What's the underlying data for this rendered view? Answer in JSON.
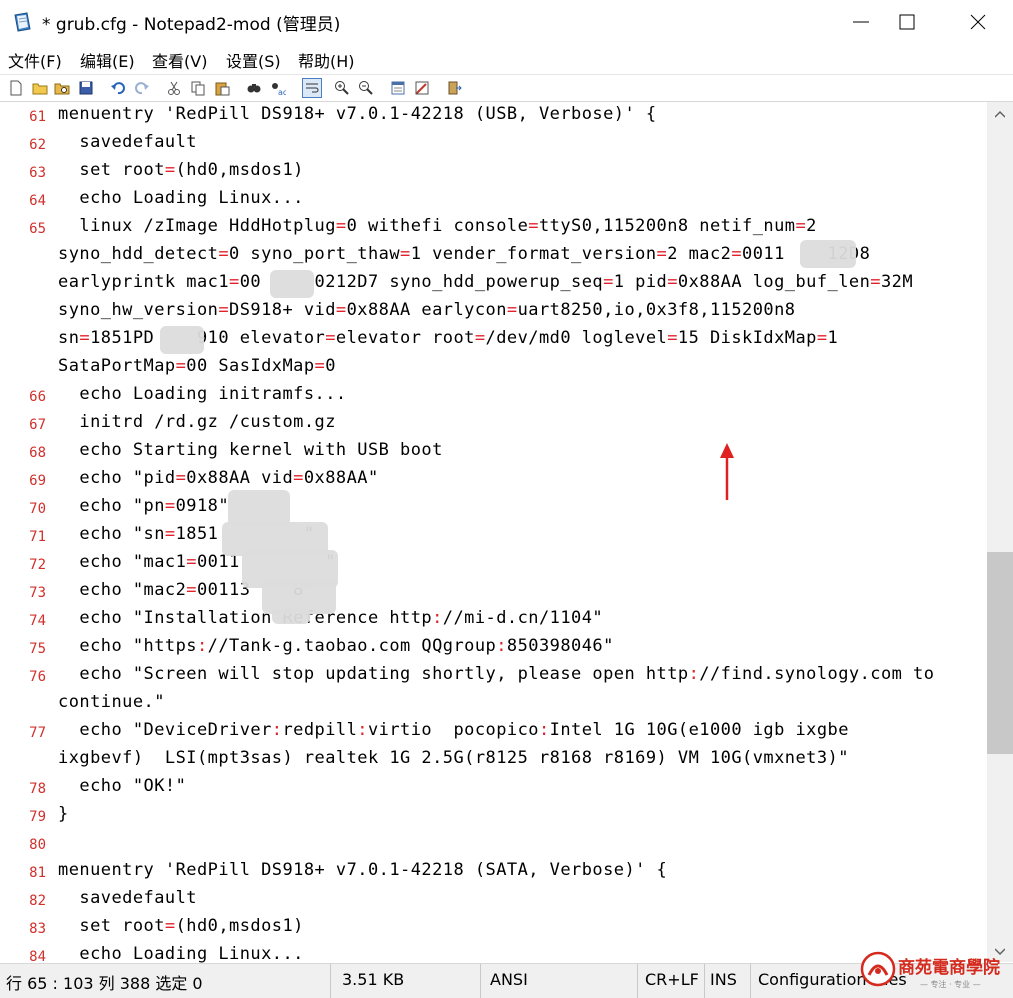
{
  "window": {
    "title": "* grub.cfg - Notepad2-mod (管理员)"
  },
  "menubar": {
    "items": [
      "文件(F)",
      "编辑(E)",
      "查看(V)",
      "设置(S)",
      "帮助(H)"
    ]
  },
  "toolbar": {
    "icons": [
      "new-file-icon",
      "open-icon",
      "browse-icon",
      "save-icon",
      "undo-icon",
      "redo-icon",
      "cut-icon",
      "copy-icon",
      "paste-icon",
      "find-icon",
      "replace-icon",
      "word-wrap-icon",
      "zoom-in-icon",
      "zoom-out-icon",
      "settings-icon",
      "scheme-icon",
      "exit-icon"
    ]
  },
  "editor": {
    "lines": [
      {
        "n": "61",
        "t": "menuentry 'RedPill DS918+ v7.0.1-42218 (USB, Verbose)' {"
      },
      {
        "n": "62",
        "t": "  savedefault"
      },
      {
        "n": "63",
        "t": "  set root=(hd0,msdos1)"
      },
      {
        "n": "64",
        "t": "  echo Loading Linux..."
      },
      {
        "n": "65",
        "t": "  linux /zImage HddHotplug=0 withefi console=ttyS0,115200n8 netif_num=2"
      },
      {
        "n": "",
        "t": "syno_hdd_detect=0 syno_port_thaw=1 vender_format_version=2 mac2=0011    12D8"
      },
      {
        "n": "",
        "t": "earlyprintk mac1=00     0212D7 syno_hdd_powerup_seq=1 pid=0x88AA log_buf_len=32M"
      },
      {
        "n": "",
        "t": "syno_hw_version=DS918+ vid=0x88AA earlycon=uart8250,io,0x3f8,115200n8"
      },
      {
        "n": "",
        "t": "sn=1851PD    910 elevator=elevator root=/dev/md0 loglevel=15 DiskIdxMap=1"
      },
      {
        "n": "",
        "t": "SataPortMap=00 SasIdxMap=0"
      },
      {
        "n": "66",
        "t": "  echo Loading initramfs..."
      },
      {
        "n": "67",
        "t": "  initrd /rd.gz /custom.gz"
      },
      {
        "n": "68",
        "t": "  echo Starting kernel with USB boot"
      },
      {
        "n": "69",
        "t": "  echo \"pid=0x88AA vid=0x88AA\""
      },
      {
        "n": "70",
        "t": "  echo \"pn=0918\""
      },
      {
        "n": "71",
        "t": "  echo \"sn=1851        \""
      },
      {
        "n": "72",
        "t": "  echo \"mac1=0011        \""
      },
      {
        "n": "73",
        "t": "  echo \"mac2=00113    8\""
      },
      {
        "n": "74",
        "t": "  echo \"Installation Reference http://mi-d.cn/1104\""
      },
      {
        "n": "75",
        "t": "  echo \"https://Tank-g.taobao.com QQgroup:850398046\""
      },
      {
        "n": "76",
        "t": "  echo \"Screen will stop updating shortly, please open http://find.synology.com to"
      },
      {
        "n": "",
        "t": "continue.\""
      },
      {
        "n": "77",
        "t": "  echo \"DeviceDriver:redpill:virtio  pocopico:Intel 1G 10G(e1000 igb ixgbe"
      },
      {
        "n": "",
        "t": "ixgbevf)  LSI(mpt3sas) realtek 1G 2.5G(r8125 r8168 r8169) VM 10G(vmxnet3)\""
      },
      {
        "n": "78",
        "t": "  echo \"OK!\""
      },
      {
        "n": "79",
        "t": "}"
      },
      {
        "n": "80",
        "t": ""
      },
      {
        "n": "81",
        "t": "menuentry 'RedPill DS918+ v7.0.1-42218 (SATA, Verbose)' {"
      },
      {
        "n": "82",
        "t": "  savedefault"
      },
      {
        "n": "83",
        "t": "  set root=(hd0,msdos1)"
      },
      {
        "n": "84",
        "t": "  echo Loading Linux..."
      }
    ]
  },
  "statusbar": {
    "position": "行 65 : 103   列 388   选定 0",
    "size": "3.51 KB",
    "encoding": "ANSI",
    "eol": "CR+LF",
    "ins": "INS",
    "scheme": "Configuration Files"
  },
  "watermark": {
    "text": "商苑電商學院",
    "sub": "— 专注 · 专业 —"
  },
  "colors": {
    "line_number": "#d0312d",
    "operator": "#e0202a",
    "arrow": "#e02020"
  }
}
